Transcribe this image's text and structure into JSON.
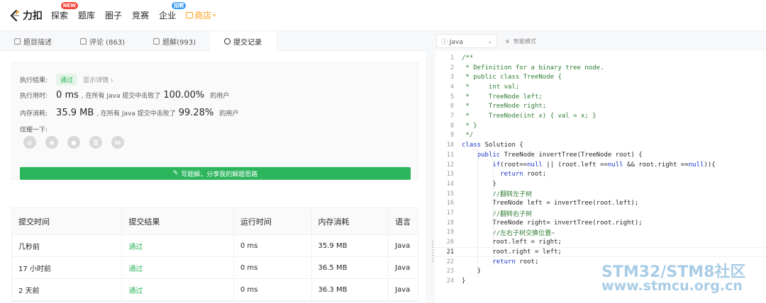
{
  "nav": {
    "logo_text": "力扣",
    "items": [
      {
        "label": "探索",
        "badge": "NEW"
      },
      {
        "label": "题库"
      },
      {
        "label": "圈子"
      },
      {
        "label": "竞赛"
      },
      {
        "label": "企业",
        "badge": "招聘"
      }
    ],
    "store_label": "商店"
  },
  "tabs": [
    {
      "label": "题目描述"
    },
    {
      "label": "评论 (863)"
    },
    {
      "label": "题解(993)"
    },
    {
      "label": "提交记录"
    }
  ],
  "result": {
    "status_label": "执行结果:",
    "status_value": "通过",
    "detail_link": "显示详情 ›",
    "time_label": "执行用时:",
    "time_value": "0 ms",
    "time_prefix": ", 在所有 Java 提交中击败了",
    "time_percent": "100.00%",
    "suffix": "的用户",
    "memory_label": "内存消耗:",
    "memory_value": "35.9 MB",
    "memory_prefix": ", 在所有 Java 提交中击败了",
    "memory_percent": "99.28%",
    "share_label": "炫耀一下:",
    "share_icons": [
      "wechat-icon",
      "weibo-icon",
      "qq-icon",
      "douban-icon",
      "linkedin-icon"
    ],
    "write_button": "写题解，分享我的解题思路"
  },
  "table": {
    "headers": [
      "提交时间",
      "提交结果",
      "运行时间",
      "内存消耗",
      "语言"
    ],
    "rows": [
      [
        "几秒前",
        "通过",
        "0 ms",
        "35.9 MB",
        "Java"
      ],
      [
        "17 小时前",
        "通过",
        "0 ms",
        "36.5 MB",
        "Java"
      ],
      [
        "2 天前",
        "通过",
        "0 ms",
        "36.3 MB",
        "Java"
      ]
    ]
  },
  "editor": {
    "language": "Java",
    "smart_mode": "智能模式",
    "lines": [
      "/**",
      " * Definition for a binary tree node.",
      " * public class TreeNode {",
      " *     int val;",
      " *     TreeNode left;",
      " *     TreeNode right;",
      " *     TreeNode(int x) { val = x; }",
      " * }",
      " */",
      "class Solution {",
      "    public TreeNode invertTree(TreeNode root) {",
      "        if(root==null || (root.left ==null && root.right ==null)){",
      "          return root;",
      "        }",
      "        //翻转左子树",
      "        TreeNode left = invertTree(root.left);",
      "        //翻转右子树",
      "        TreeNode right= invertTree(root.right);",
      "        //左右子树交换位置~",
      "        root.left = right;",
      "        root.right = left;",
      "        return root;",
      "    }",
      "}"
    ],
    "current_line": 21
  },
  "watermark": {
    "line1": "STM32/STM8社区",
    "line2": "www.stmcu.org.cn"
  },
  "colors": {
    "accent_green": "#2db55d",
    "store_orange": "#ffa116"
  }
}
